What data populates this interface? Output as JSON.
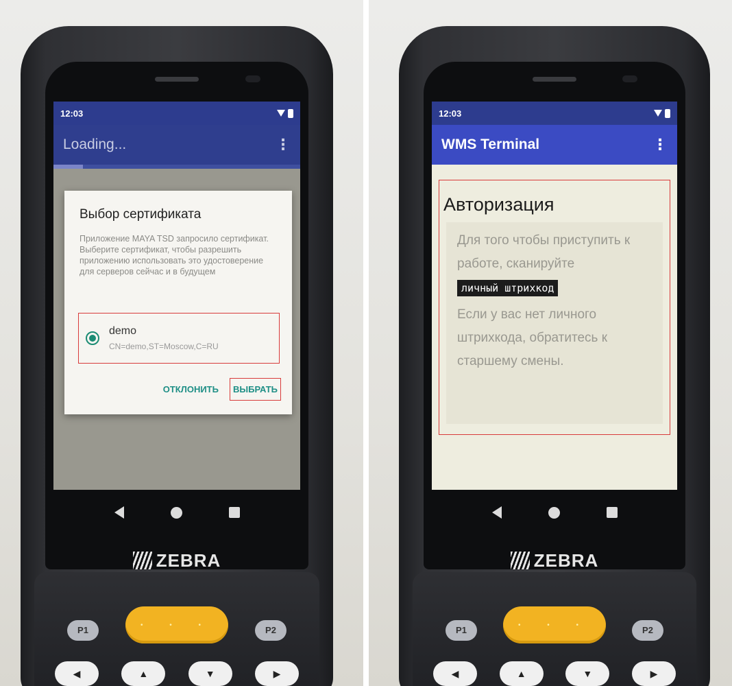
{
  "left_screen": {
    "status_time": "12:03",
    "app_title": "Loading...",
    "dialog": {
      "title": "Выбор сертификата",
      "body": "Приложение MAYA TSD запросило сертификат. Выберите сертификат, чтобы разрешить приложению использовать это удостоверение для серверов сейчас и в будущем",
      "certificate": {
        "name": "demo",
        "subject": "CN=demo,ST=Moscow,C=RU",
        "selected": true
      },
      "deny_label": "ОТКЛОНИТЬ",
      "select_label": "ВЫБРАТЬ"
    }
  },
  "right_screen": {
    "status_time": "12:03",
    "app_title": "WMS Terminal",
    "auth": {
      "title": "Авторизация",
      "instruction": "Для того чтобы приступить к работе, сканируйте",
      "barcode_label": "личный штрихкод",
      "help": "Если у вас нет личного штрихкода, обратитесь к старшему смены."
    }
  },
  "device": {
    "brand": "ZEBRA",
    "key_p1": "P1",
    "key_p2": "P2"
  },
  "colors": {
    "app_bar": "#3b4bc3",
    "status_bar": "#2d3c8e",
    "accent_teal": "#1f8f86",
    "highlight_red": "#d83a3a",
    "scan_key": "#f2b322"
  }
}
